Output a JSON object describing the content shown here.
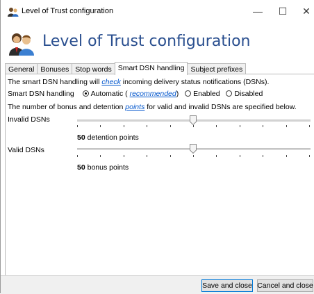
{
  "window": {
    "title": "Level of Trust configuration",
    "minimize": "—",
    "maximize": "☐",
    "close": "✕"
  },
  "header": {
    "title": "Level of Trust configuration"
  },
  "tabs": [
    {
      "label": "General"
    },
    {
      "label": "Bonuses"
    },
    {
      "label": "Stop words"
    },
    {
      "label": "Smart DSN handling",
      "active": true
    },
    {
      "label": "Subject prefixes"
    }
  ],
  "content": {
    "intro_pre": "The smart DSN handling will ",
    "intro_link": "check",
    "intro_post": " incoming delivery status notifications (DSNs).",
    "mode_label": "Smart DSN handling",
    "mode_auto": "Automatic (",
    "mode_auto_link": "recommended",
    "mode_auto_close": ")",
    "mode_enabled": "Enabled",
    "mode_disabled": "Disabled",
    "mode_selected": "Automatic",
    "points_pre": "The number of bonus and detention ",
    "points_link": "points",
    "points_post": " for valid and invalid DSNs are specified below.",
    "invalid": {
      "label": "Invalid DSNs",
      "value": "50",
      "unit": "detention points",
      "level": 0.5
    },
    "valid": {
      "label": "Valid DSNs",
      "value": "50",
      "unit": "bonus points",
      "level": 0.5
    }
  },
  "buttons": {
    "save": "Save and close",
    "cancel": "Cancel and close"
  }
}
